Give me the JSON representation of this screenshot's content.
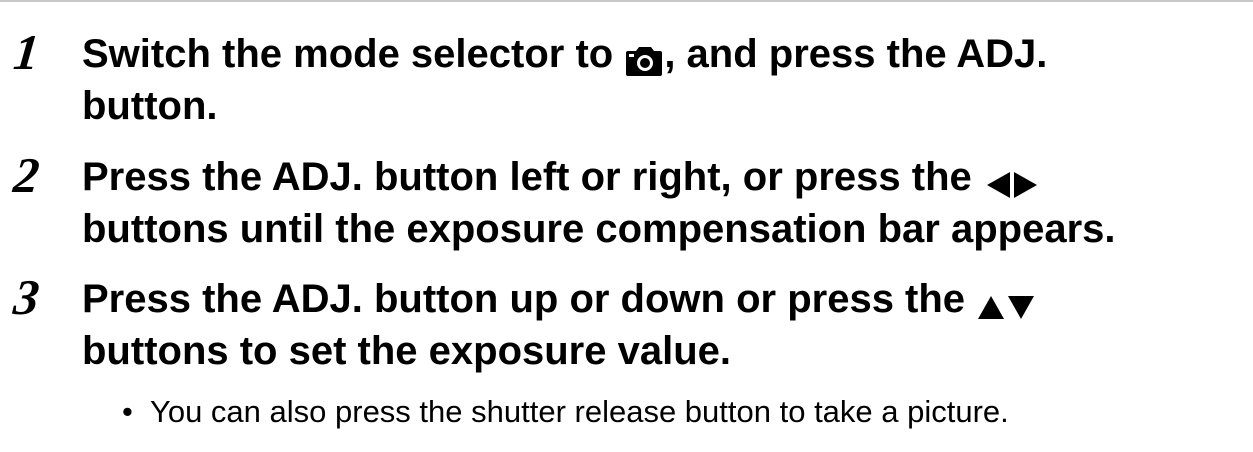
{
  "steps": [
    {
      "number": "1",
      "line1_before_icon": "Switch the mode selector to ",
      "icon": "camera-icon",
      "line1_after_icon": ", and press the ADJ.",
      "line2": "button."
    },
    {
      "number": "2",
      "line1_before_icon": "Press the ADJ. button left or right, or press the ",
      "icon": "left-right-arrows-icon",
      "line2": "buttons until the exposure compensation bar appears."
    },
    {
      "number": "3",
      "line1_before_icon": "Press the ADJ. button up or down or press the ",
      "icon": "up-down-arrows-icon",
      "line2": "buttons to set the exposure value."
    }
  ],
  "note": {
    "bullet": "•",
    "text": "You can also press the shutter release button to take a picture."
  }
}
